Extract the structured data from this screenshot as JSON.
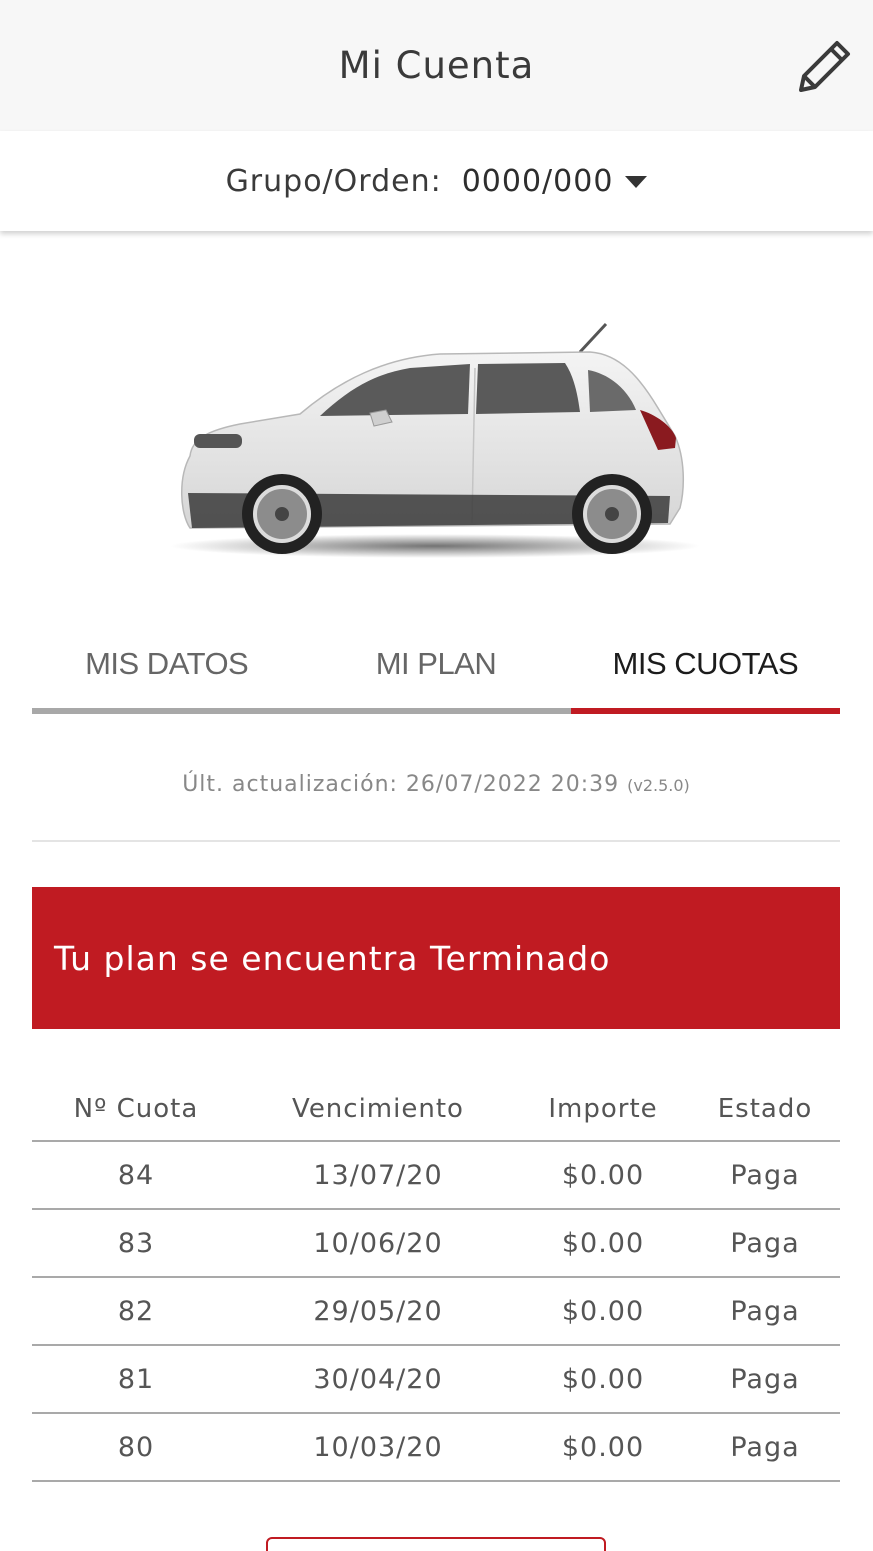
{
  "header": {
    "title": "Mi Cuenta",
    "edit_icon": "pencil-icon"
  },
  "group": {
    "label": "Grupo/Orden:",
    "value": "0000/000"
  },
  "tabs": [
    {
      "label": "MIS DATOS",
      "active": false
    },
    {
      "label": "MI PLAN",
      "active": false
    },
    {
      "label": "MIS CUOTAS",
      "active": true
    }
  ],
  "update": {
    "label": "Últ. actualización:",
    "datetime": "26/07/2022 20:39",
    "version": "(v2.5.0)"
  },
  "status": {
    "text": "Tu plan se encuentra Terminado"
  },
  "table": {
    "headers": [
      "Nº Cuota",
      "Vencimiento",
      "Importe",
      "Estado"
    ],
    "rows": [
      [
        "84",
        "13/07/20",
        "$0.00",
        "Paga"
      ],
      [
        "83",
        "10/06/20",
        "$0.00",
        "Paga"
      ],
      [
        "82",
        "29/05/20",
        "$0.00",
        "Paga"
      ],
      [
        "81",
        "30/04/20",
        "$0.00",
        "Paga"
      ],
      [
        "80",
        "10/03/20",
        "$0.00",
        "Paga"
      ]
    ]
  },
  "colors": {
    "accent": "#c01b22",
    "header_bg": "#f7f7f7",
    "tab_inactive_line": "#a8a8a8"
  }
}
